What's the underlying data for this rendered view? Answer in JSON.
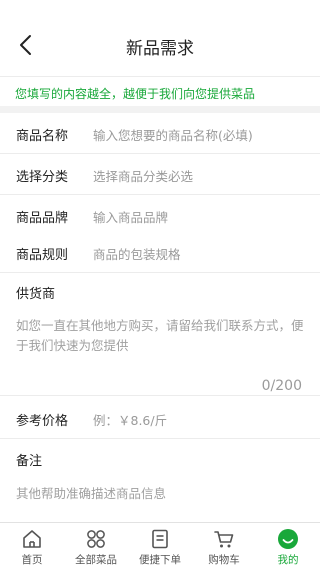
{
  "header": {
    "title": "新品需求"
  },
  "hint": "您填写的内容越全，越便于我们向您提供菜品",
  "form": {
    "name": {
      "label": "商品名称",
      "placeholder": "输入您想要的商品名称(必填)"
    },
    "category": {
      "label": "选择分类",
      "placeholder": "选择商品分类必选"
    },
    "brand": {
      "label": "商品品牌",
      "placeholder": "输入商品品牌"
    },
    "spec": {
      "label": "商品规则",
      "placeholder": "商品的包装规格"
    },
    "supplier": {
      "label": "供货商",
      "placeholder": "如您一直在其他地方购买，请留给我们联系方式，便于我们快速为您提供",
      "counter": "0/200"
    },
    "price": {
      "label": "参考价格",
      "placeholder": "例：￥8.6/斤"
    },
    "note": {
      "label": "备注",
      "placeholder": "其他帮助准确描述商品信息"
    }
  },
  "tabbar": {
    "items": [
      {
        "label": "首页",
        "icon": "home-icon"
      },
      {
        "label": "全部菜品",
        "icon": "grid-icon"
      },
      {
        "label": "便捷下单",
        "icon": "order-icon"
      },
      {
        "label": "购物车",
        "icon": "cart-icon"
      },
      {
        "label": "我的",
        "icon": "profile-icon"
      }
    ],
    "active_color": "#19a83a"
  }
}
